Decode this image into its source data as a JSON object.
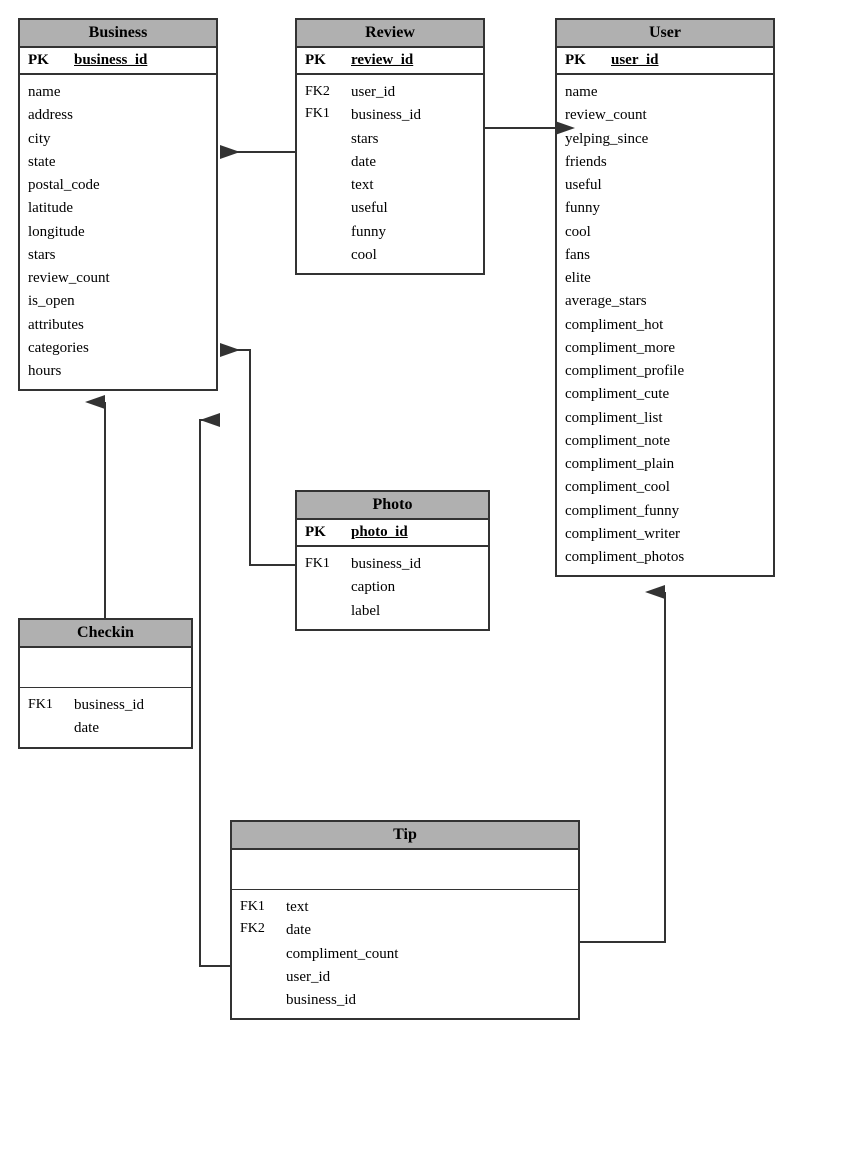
{
  "entities": {
    "business": {
      "title": "Business",
      "pk_label": "PK",
      "pk_field": "business_id",
      "fields": [
        "name",
        "address",
        "city",
        "state",
        "postal_code",
        "latitude",
        "longitude",
        "stars",
        "review_count",
        "is_open",
        "attributes",
        "categories",
        "hours"
      ]
    },
    "review": {
      "title": "Review",
      "pk_label": "PK",
      "pk_field": "review_id",
      "fk_labels": [
        "FK2",
        "FK1"
      ],
      "fk_fields": [
        "user_id",
        "business_id"
      ],
      "fields": [
        "stars",
        "date",
        "text",
        "useful",
        "funny",
        "cool"
      ]
    },
    "user": {
      "title": "User",
      "pk_label": "PK",
      "pk_field": "user_id",
      "fields": [
        "name",
        "review_count",
        "yelping_since",
        "friends",
        "useful",
        "funny",
        "cool",
        "fans",
        "elite",
        "average_stars",
        "compliment_hot",
        "compliment_more",
        "compliment_profile",
        "compliment_cute",
        "compliment_list",
        "compliment_note",
        "compliment_plain",
        "compliment_cool",
        "compliment_funny",
        "compliment_writer",
        "compliment_photos"
      ]
    },
    "checkin": {
      "title": "Checkin",
      "fk_label": "FK1",
      "fk_fields": [
        "business_id",
        "date"
      ]
    },
    "photo": {
      "title": "Photo",
      "pk_label": "PK",
      "pk_field": "photo_id",
      "fk_label": "FK1",
      "fk_fields": [
        "business_id",
        "caption",
        "label"
      ]
    },
    "tip": {
      "title": "Tip",
      "fk_labels": [
        "FK1",
        "FK2"
      ],
      "fk_fields": {
        "top": [
          "text",
          "date",
          "compliment_count"
        ],
        "fk1": "user_id",
        "fk2": "business_id"
      }
    }
  },
  "arrows": {
    "description": "ERD relationship arrows"
  }
}
